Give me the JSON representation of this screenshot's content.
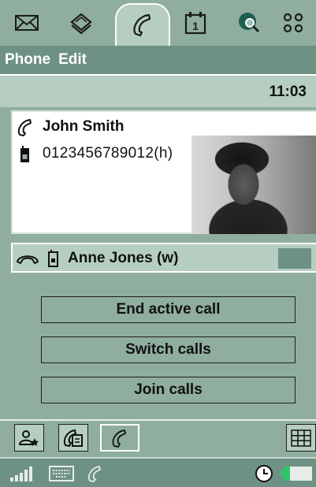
{
  "tabs": [
    {
      "name": "messaging",
      "icon": "envelope-icon",
      "active": false
    },
    {
      "name": "contacts",
      "icon": "contacts-book-icon",
      "active": false
    },
    {
      "name": "phone",
      "icon": "phone-handset-icon",
      "active": true
    },
    {
      "name": "calendar",
      "icon": "calendar-icon",
      "active": false,
      "calendar_day": "1"
    },
    {
      "name": "web",
      "icon": "globe-search-icon",
      "active": false
    },
    {
      "name": "applications",
      "icon": "app-grid-icon",
      "active": false
    }
  ],
  "menu": {
    "items": [
      "Phone",
      "Edit"
    ]
  },
  "status": {
    "time": "11:03"
  },
  "active_call": {
    "contact_name": "John Smith",
    "number": "0123456789012(h)",
    "icons": [
      "phone-handset-icon",
      "mobile-phone-icon"
    ],
    "photo": "contact-photo"
  },
  "held_call": {
    "contact_name": "Anne Jones (w)",
    "icons": [
      "hangup-handset-icon",
      "mobile-phone-icon"
    ]
  },
  "actions": {
    "end_active": "End active call",
    "switch": "Switch calls",
    "join": "Join calls"
  },
  "toolbar": {
    "buttons": [
      "contact-favourite-icon",
      "call-log-icon",
      "dial-handset-icon",
      "keypad-grid-icon"
    ]
  },
  "statusbar": {
    "icons": [
      "signal-strength-icon",
      "keyboard-icon",
      "phone-handset-icon",
      "clock-icon",
      "battery-icon"
    ]
  },
  "colors": {
    "background": "#8fae9f",
    "header_dark": "#6e9185",
    "panel_light": "#b6cec1",
    "card": "#ffffff",
    "text": "#111111"
  }
}
